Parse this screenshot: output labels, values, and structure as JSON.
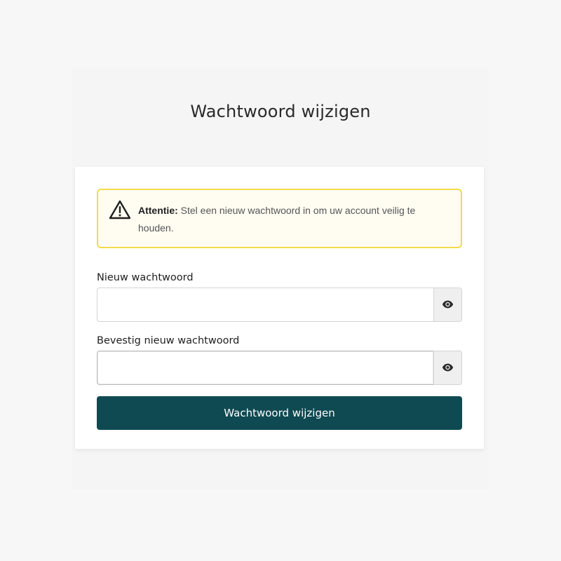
{
  "page": {
    "title": "Wachtwoord wijzigen"
  },
  "alert": {
    "icon": "warning-triangle-icon",
    "label": "Attentie:",
    "message": " Stel een nieuw wachtwoord in om uw account veilig te houden."
  },
  "form": {
    "new_password": {
      "label": "Nieuw wachtwoord",
      "value": "",
      "toggle_icon": "eye-icon"
    },
    "confirm_password": {
      "label": "Bevestig nieuw wachtwoord",
      "value": "",
      "toggle_icon": "eye-icon"
    },
    "submit_label": "Wachtwoord wijzigen"
  },
  "colors": {
    "page_background": "#f7f7f7",
    "alert_border": "#f2dc4a",
    "alert_background": "#fffcf2",
    "primary_button": "#0f4a52",
    "eye_button_background": "#efefef"
  }
}
